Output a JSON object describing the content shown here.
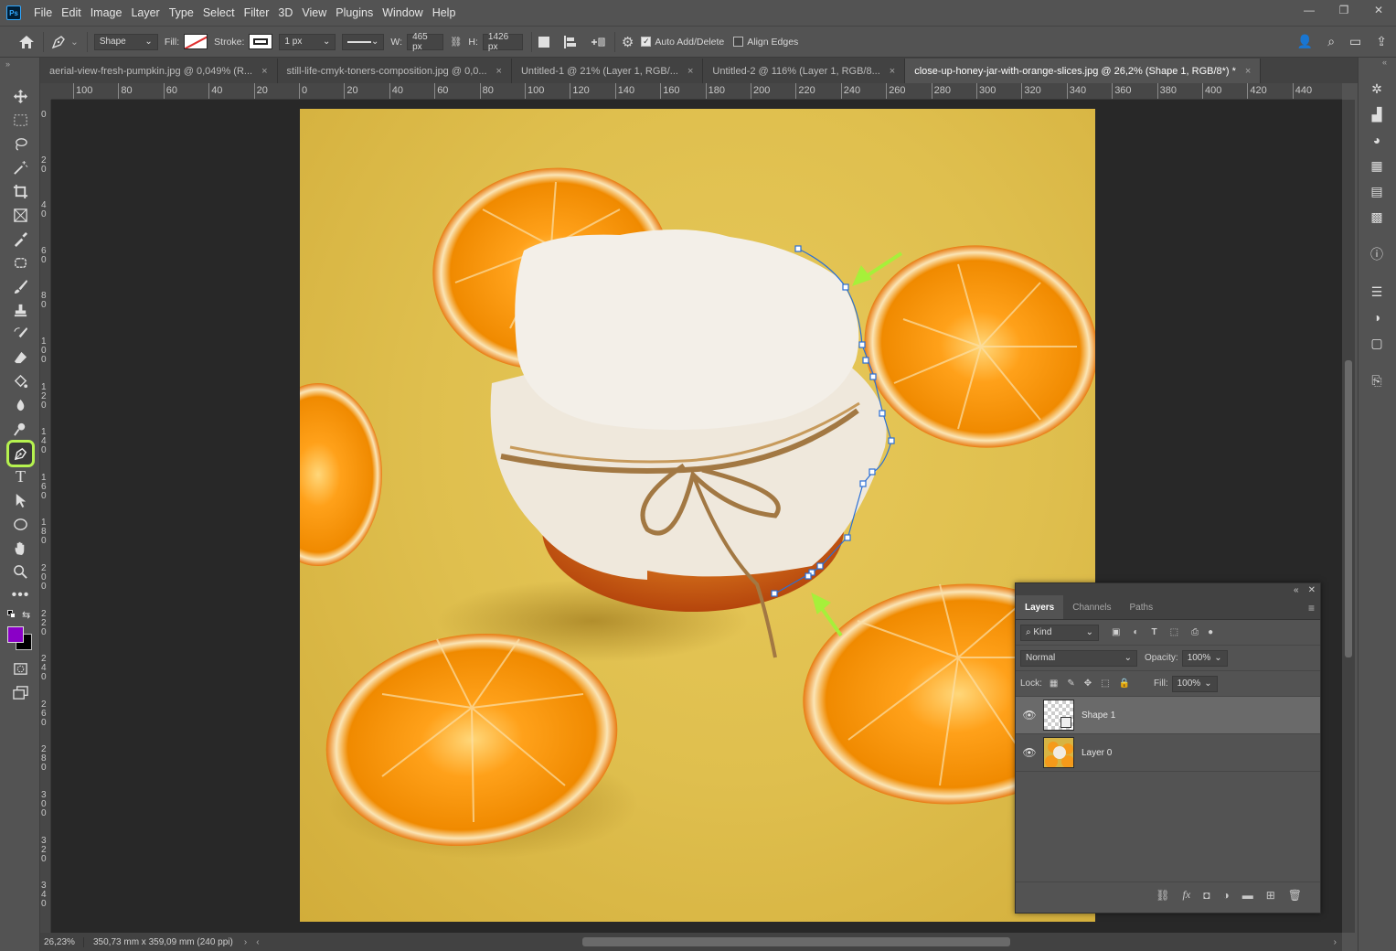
{
  "app": {
    "logo": "Ps"
  },
  "menu": [
    "File",
    "Edit",
    "Image",
    "Layer",
    "Type",
    "Select",
    "Filter",
    "3D",
    "View",
    "Plugins",
    "Window",
    "Help"
  ],
  "window_controls": {
    "minimize": "—",
    "restore": "❐",
    "close": "✕"
  },
  "options": {
    "mode": "Shape",
    "fill_label": "Fill:",
    "stroke_label": "Stroke:",
    "stroke_width": "1 px",
    "w_label": "W:",
    "w_value": "465 px",
    "h_label": "H:",
    "h_value": "1426 px",
    "auto_add_delete": "Auto Add/Delete",
    "auto_add_delete_checked": true,
    "align_edges": "Align Edges",
    "align_edges_checked": false
  },
  "tabs": [
    {
      "label": "aerial-view-fresh-pumpkin.jpg @ 0,049% (R...",
      "close": "×"
    },
    {
      "label": "still-life-cmyk-toners-composition.jpg @ 0,0...",
      "close": "×"
    },
    {
      "label": "Untitled-1 @ 21% (Layer 1, RGB/...",
      "close": "×"
    },
    {
      "label": "Untitled-2 @ 116% (Layer 1, RGB/8...",
      "close": "×"
    },
    {
      "label": "close-up-honey-jar-with-orange-slices.jpg @ 26,2% (Shape 1, RGB/8*) *",
      "close": "×",
      "active": true
    }
  ],
  "ruler_top": [
    "100",
    "80",
    "60",
    "40",
    "20",
    "0",
    "20",
    "40",
    "60",
    "80",
    "100",
    "120",
    "140",
    "160",
    "180",
    "200",
    "220",
    "240",
    "260",
    "280",
    "300",
    "320",
    "340",
    "360",
    "380",
    "400",
    "420",
    "440"
  ],
  "ruler_left": [
    "0",
    "20",
    "40",
    "60",
    "80",
    "100",
    "120",
    "140",
    "160",
    "180",
    "200",
    "220",
    "240",
    "260",
    "280",
    "300",
    "320",
    "340"
  ],
  "status": {
    "zoom": "26,23%",
    "doc_info": "350,73 mm x 359,09 mm (240 ppi)"
  },
  "colors": {
    "foreground": "#8a00c7",
    "background": "#000000",
    "highlight": "#b5f24f",
    "arrow": "#a6f03a"
  },
  "layers_panel": {
    "tabs": [
      "Layers",
      "Channels",
      "Paths"
    ],
    "filter_label": "Kind",
    "blend_mode": "Normal",
    "opacity_label": "Opacity:",
    "opacity_value": "100%",
    "lock_label": "Lock:",
    "fill_label": "Fill:",
    "fill_value": "100%",
    "layers": [
      {
        "name": "Shape 1",
        "selected": true
      },
      {
        "name": "Layer 0",
        "selected": false
      }
    ]
  }
}
